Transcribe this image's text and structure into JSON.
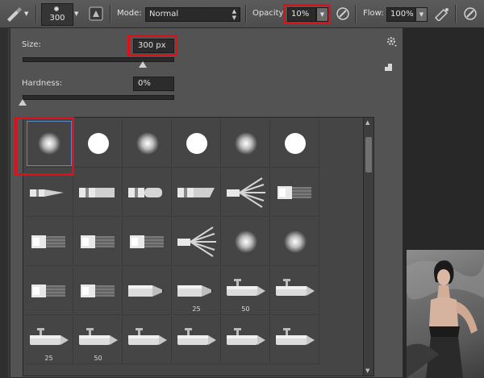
{
  "options_bar": {
    "brush_size": "300",
    "mode_label": "Mode:",
    "mode_value": "Normal",
    "opacity_label": "Opacity:",
    "opacity_value": "10%",
    "flow_label": "Flow:",
    "flow_value": "100%",
    "icons": [
      "brush-tool-icon",
      "brush-preset-picker",
      "toggle-brush-panel-icon",
      "pressure-opacity-icon",
      "airbrush-icon",
      "pressure-size-icon"
    ]
  },
  "brush_panel": {
    "size_label": "Size:",
    "size_value": "300 px",
    "size_slider_fraction": 0.5,
    "hardness_label": "Hardness:",
    "hardness_value": "0%",
    "hardness_slider_fraction": 0.0,
    "icons": [
      "gear-icon",
      "new-preset-icon"
    ]
  },
  "brush_presets": [
    {
      "type": "soft-round",
      "label": ""
    },
    {
      "type": "hard-round",
      "label": ""
    },
    {
      "type": "soft-round",
      "label": ""
    },
    {
      "type": "hard-round",
      "label": ""
    },
    {
      "type": "soft-round",
      "label": ""
    },
    {
      "type": "hard-round",
      "label": ""
    },
    {
      "type": "round-point-brush",
      "label": ""
    },
    {
      "type": "flat-brush",
      "label": ""
    },
    {
      "type": "round-blunt-brush",
      "label": ""
    },
    {
      "type": "angled-brush",
      "label": ""
    },
    {
      "type": "fan-brush",
      "label": ""
    },
    {
      "type": "flat-bristle-brush",
      "label": ""
    },
    {
      "type": "flat-bristle-brush",
      "label": ""
    },
    {
      "type": "flat-bristle-brush",
      "label": ""
    },
    {
      "type": "flat-bristle-brush",
      "label": ""
    },
    {
      "type": "fan-brush",
      "label": ""
    },
    {
      "type": "soft-round",
      "label": ""
    },
    {
      "type": "soft-round",
      "label": ""
    },
    {
      "type": "flat-bristle-brush",
      "label": ""
    },
    {
      "type": "flat-bristle-brush",
      "label": ""
    },
    {
      "type": "pencil",
      "label": ""
    },
    {
      "type": "pencil",
      "label": "25"
    },
    {
      "type": "airbrush",
      "label": "50"
    },
    {
      "type": "airbrush",
      "label": ""
    },
    {
      "type": "airbrush",
      "label": "25"
    },
    {
      "type": "airbrush",
      "label": "50"
    },
    {
      "type": "airbrush",
      "label": ""
    },
    {
      "type": "airbrush",
      "label": ""
    },
    {
      "type": "airbrush",
      "label": ""
    },
    {
      "type": "airbrush",
      "label": ""
    }
  ],
  "selected_preset_index": 0
}
